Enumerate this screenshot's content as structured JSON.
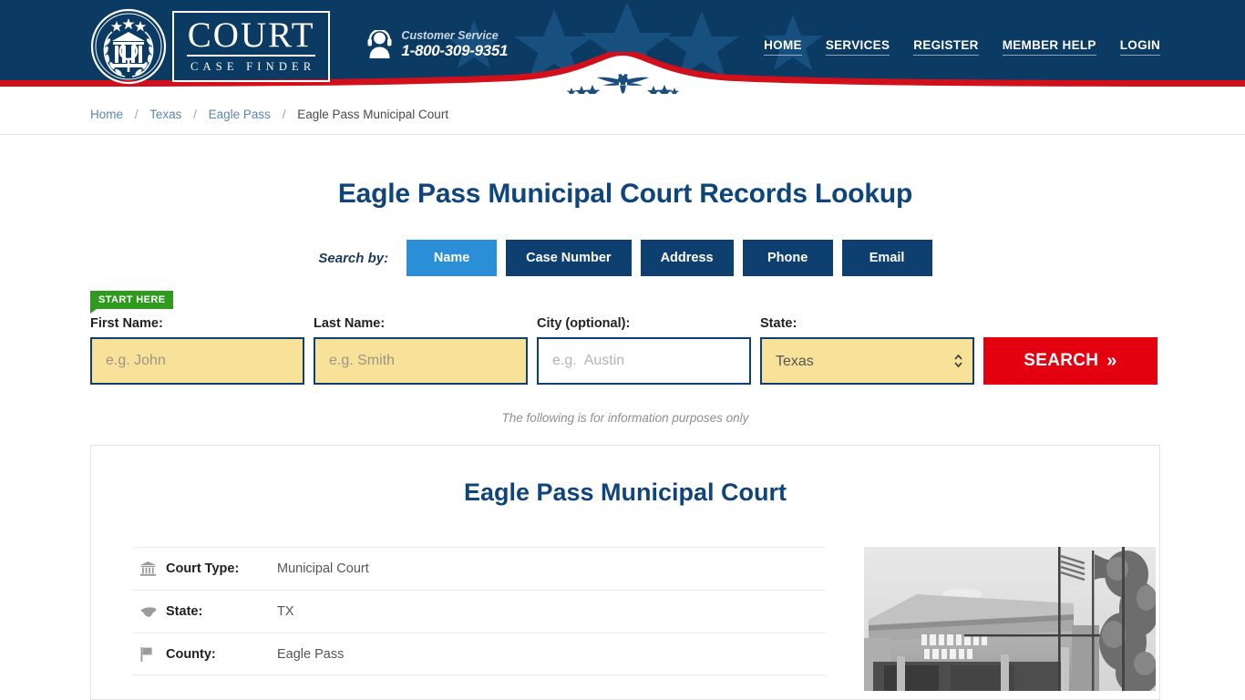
{
  "header": {
    "logo": {
      "emblem_icon": "court-seal-icon",
      "title": "COURT",
      "subtitle": "CASE FINDER"
    },
    "customer_service": {
      "icon": "headset-support-icon",
      "label": "Customer Service",
      "phone": "1-800-309-9351"
    },
    "nav": [
      {
        "label": "HOME"
      },
      {
        "label": "SERVICES"
      },
      {
        "label": "REGISTER"
      },
      {
        "label": "MEMBER HELP"
      },
      {
        "label": "LOGIN"
      }
    ],
    "banner": {
      "emblem_icon": "eagle-emblem-icon"
    },
    "colors": {
      "header_blue": "#0b3a63",
      "banner_red": "#d2101c",
      "star_blue": "#17507e"
    }
  },
  "breadcrumb": {
    "separator": "/",
    "items": [
      {
        "label": "Home",
        "current": false
      },
      {
        "label": "Texas",
        "current": false
      },
      {
        "label": "Eagle Pass",
        "current": false
      },
      {
        "label": "Eagle Pass Municipal Court",
        "current": true
      }
    ]
  },
  "main": {
    "page_title": "Eagle Pass Municipal Court Records Lookup",
    "search_by_label": "Search by:",
    "tabs": [
      {
        "label": "Name",
        "active": true
      },
      {
        "label": "Case Number",
        "active": false
      },
      {
        "label": "Address",
        "active": false
      },
      {
        "label": "Phone",
        "active": false
      },
      {
        "label": "Email",
        "active": false
      }
    ],
    "start_here_badge": "START HERE",
    "form": {
      "first_name": {
        "label": "First Name:",
        "value": "",
        "placeholder": "e.g. John"
      },
      "last_name": {
        "label": "Last Name:",
        "value": "",
        "placeholder": "e.g. Smith"
      },
      "city": {
        "label": "City (optional):",
        "value": "",
        "placeholder": "e.g.  Austin"
      },
      "state": {
        "label": "State:",
        "value": "Texas",
        "options": [
          "Texas"
        ]
      },
      "search_button": {
        "label": "SEARCH",
        "chevron": "»"
      }
    },
    "info_note": "The following is for information purposes only",
    "accent_colors": {
      "active_tab": "#2b8fd8",
      "inactive_tab": "#0d4071",
      "search_red": "#e3000f",
      "start_here_green": "#2e9b1e",
      "field_highlight": "#f8e29a"
    }
  },
  "card": {
    "title": "Eagle Pass Municipal Court",
    "details": [
      {
        "icon": "bank-building-icon",
        "label": "Court Type:",
        "value": "Municipal Court"
      },
      {
        "icon": "us-map-icon",
        "label": "State:",
        "value": "TX"
      },
      {
        "icon": "flag-icon",
        "label": "County:",
        "value": "Eagle Pass"
      }
    ],
    "photo": {
      "alt": "Eagle Pass City Hall building with flags"
    }
  }
}
